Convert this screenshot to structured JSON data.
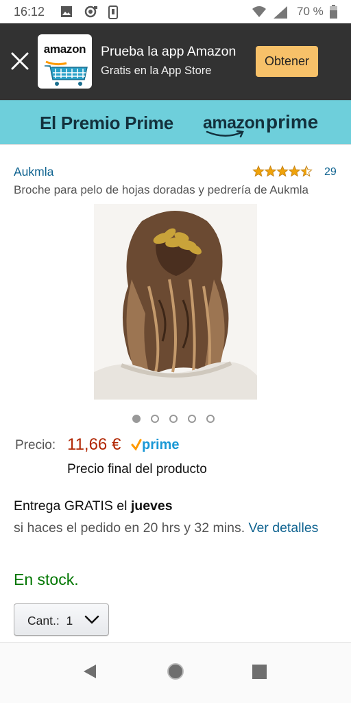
{
  "status_bar": {
    "time": "16:12",
    "battery": "70 %",
    "icons": [
      "image-icon",
      "sync-icon",
      "phone-icon",
      "wifi-icon",
      "signal-icon",
      "battery-icon"
    ]
  },
  "app_banner": {
    "logo_word": "amazon",
    "title": "Prueba la app Amazon",
    "subtitle": "Gratis en la App Store",
    "get_button": "Obtener",
    "close_icon": "close-icon"
  },
  "prime_strip": {
    "left_text": "El Premio Prime",
    "brand_amazon": "amazon",
    "brand_prime": "prime",
    "background": "#6ecfdb"
  },
  "product": {
    "brand": "Aukmla",
    "rating_count": "29",
    "rating_stars": 4.5,
    "title": "Broche para pelo de hojas doradas y pedrería de Aukmla",
    "image_count": 5,
    "active_image": 1
  },
  "price": {
    "label": "Precio:",
    "value": "11,66 €",
    "prime_badge": "prime",
    "note": "Precio final del producto",
    "color": "#b12704"
  },
  "delivery": {
    "line1_prefix": "Entrega GRATIS el ",
    "line1_day": "jueves",
    "line2": "si haces el pedido en 20 hrs y 32 mins. ",
    "link": "Ver detalles"
  },
  "stock": {
    "text": "En stock.",
    "color": "#007600"
  },
  "quantity": {
    "label": "Cant.:",
    "value": "1"
  },
  "nav_bar": {
    "back": "back-icon",
    "home": "home-icon",
    "recents": "recents-icon"
  }
}
